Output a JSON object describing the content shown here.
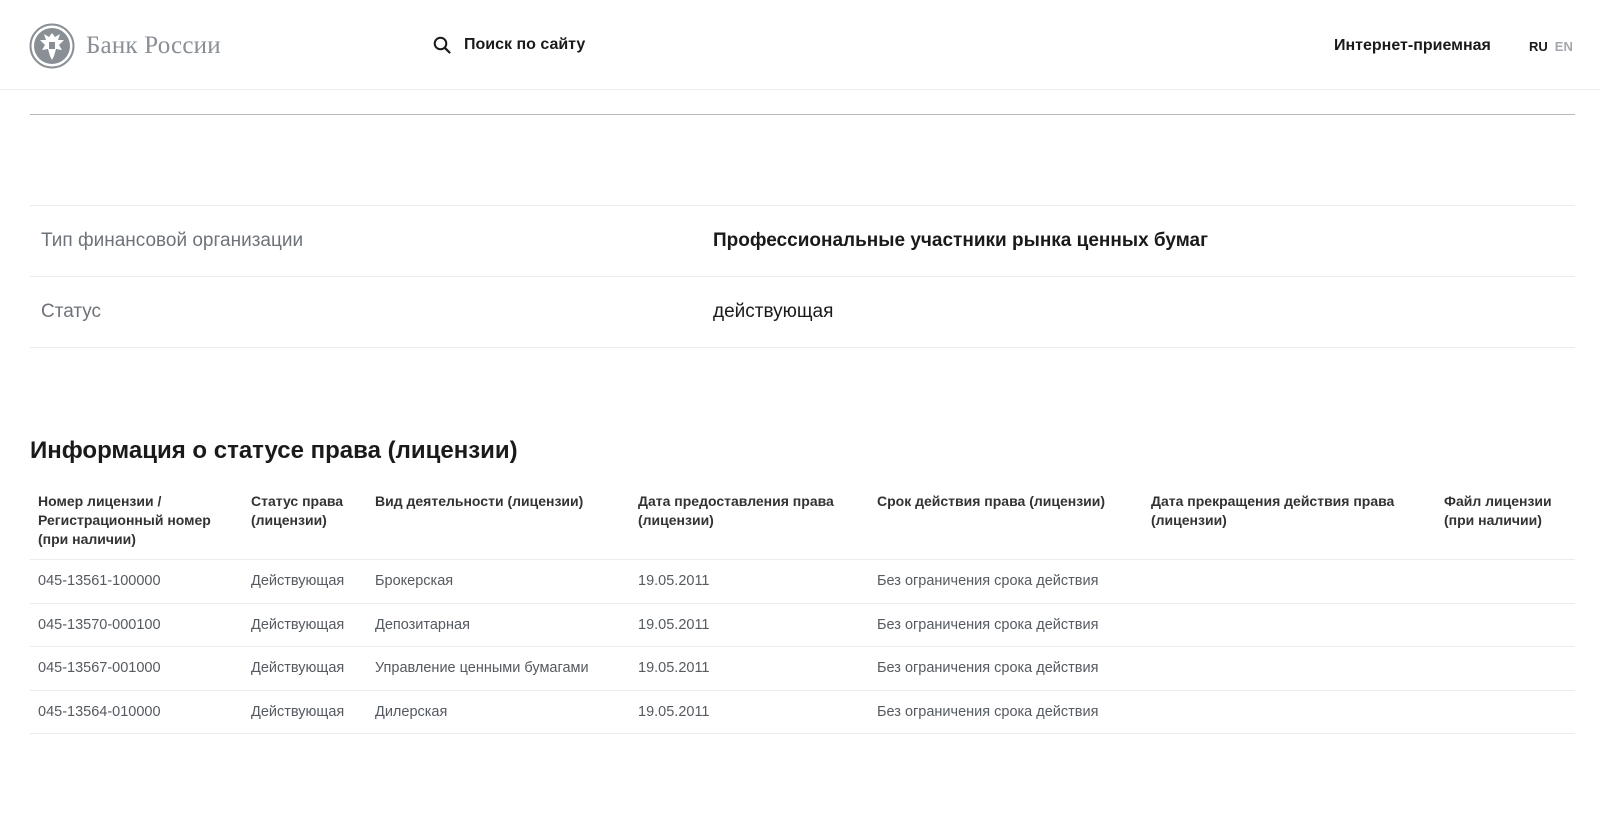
{
  "header": {
    "logo_text": "Банк России",
    "search_label": "Поиск по сайту",
    "reception_link": "Интернет-приемная",
    "lang_ru": "RU",
    "lang_en": "EN"
  },
  "info": {
    "rows": [
      {
        "label": "Тип финансовой организации",
        "value": "Профессиональные участники рынка ценных бумаг"
      },
      {
        "label": "Статус",
        "value": "действующая"
      }
    ]
  },
  "licenses": {
    "title": "Информация о статусе права (лицензии)",
    "columns": [
      "Номер лицензии / Регистрационный номер (при наличии)",
      "Статус права (лицензии)",
      "Вид деятельности (лицензии)",
      "Дата предоставления права (лицензии)",
      "Срок действия права (лицензии)",
      "Дата прекращения действия права (лицензии)",
      "Файл лицензии (при наличии)"
    ],
    "rows": [
      [
        "045-13561-100000",
        "Действующая",
        "Брокерская",
        "19.05.2011",
        "Без ограничения срока действия",
        "",
        ""
      ],
      [
        "045-13570-000100",
        "Действующая",
        "Депозитарная",
        "19.05.2011",
        "Без ограничения срока действия",
        "",
        ""
      ],
      [
        "045-13567-001000",
        "Действующая",
        "Управление ценными бумагами",
        "19.05.2011",
        "Без ограничения срока действия",
        "",
        ""
      ],
      [
        "045-13564-010000",
        "Действующая",
        "Дилерская",
        "19.05.2011",
        "Без ограничения срока действия",
        "",
        ""
      ]
    ]
  },
  "icons": {
    "logo": "double-headed-eagle-emblem",
    "search": "search-icon"
  },
  "colors": {
    "text": "#1a1a1a",
    "muted": "#6e737a",
    "logo_gray": "#8a8f96",
    "divider": "#ececec"
  }
}
